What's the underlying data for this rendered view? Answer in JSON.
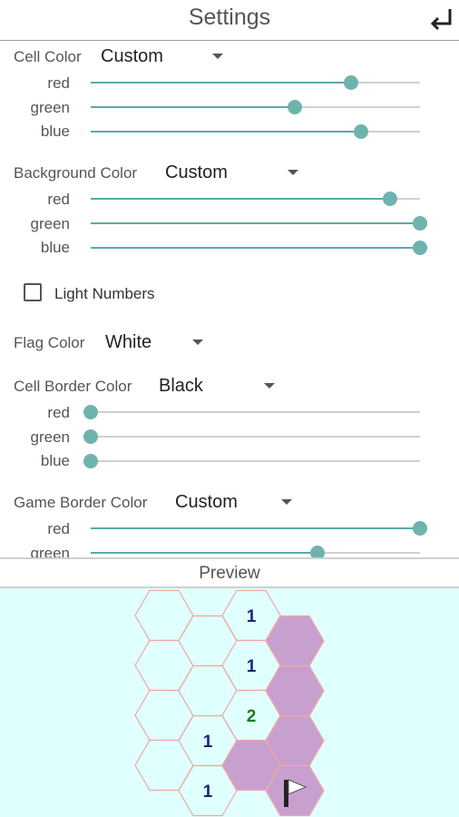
{
  "header": {
    "title": "Settings",
    "back_icon": "return-arrow-icon"
  },
  "cell_color": {
    "label": "Cell Color",
    "value": "Custom",
    "channels": [
      {
        "name": "red",
        "level": 0.79
      },
      {
        "name": "green",
        "level": 0.62
      },
      {
        "name": "blue",
        "level": 0.82
      }
    ]
  },
  "background_color": {
    "label": "Background Color",
    "value": "Custom",
    "channels": [
      {
        "name": "red",
        "level": 0.91
      },
      {
        "name": "green",
        "level": 1.0
      },
      {
        "name": "blue",
        "level": 1.0
      }
    ]
  },
  "light_numbers": {
    "label": "Light Numbers",
    "checked": false
  },
  "flag_color": {
    "label": "Flag Color",
    "value": "White"
  },
  "cell_border_color": {
    "label": "Cell Border Color",
    "value": "Black",
    "channels": [
      {
        "name": "red",
        "level": 0.0
      },
      {
        "name": "green",
        "level": 0.0
      },
      {
        "name": "blue",
        "level": 0.0
      }
    ]
  },
  "game_border_color": {
    "label": "Game Border Color",
    "value": "Custom",
    "channels": [
      {
        "name": "red",
        "level": 1.0
      },
      {
        "name": "green",
        "level": 0.69
      }
    ]
  },
  "preview": {
    "label": "Preview"
  },
  "colors": {
    "accent": "#5aaba5",
    "preview_bg": "#e0ffff",
    "hex_border": "#f0a8a0",
    "hex_covered": "#c8a0d0",
    "number_blue": "#1a237e",
    "number_green": "#1b7d1b"
  },
  "board": {
    "cells": [
      {
        "col": 0,
        "row": 0,
        "state": "open",
        "text": ""
      },
      {
        "col": 0,
        "row": 1,
        "state": "open",
        "text": ""
      },
      {
        "col": 0,
        "row": 2,
        "state": "open",
        "text": ""
      },
      {
        "col": 0,
        "row": 3,
        "state": "open",
        "text": ""
      },
      {
        "col": 1,
        "row": 0,
        "state": "open",
        "text": ""
      },
      {
        "col": 1,
        "row": 1,
        "state": "open",
        "text": ""
      },
      {
        "col": 1,
        "row": 2,
        "state": "open",
        "text": "1"
      },
      {
        "col": 1,
        "row": 3,
        "state": "open",
        "text": "1"
      },
      {
        "col": 2,
        "row": 0,
        "state": "open",
        "text": "1"
      },
      {
        "col": 2,
        "row": 1,
        "state": "open",
        "text": "1"
      },
      {
        "col": 2,
        "row": 2,
        "state": "open",
        "text": "2"
      },
      {
        "col": 2,
        "row": 3,
        "state": "covered",
        "text": ""
      },
      {
        "col": 3,
        "row": 0,
        "state": "covered",
        "text": ""
      },
      {
        "col": 3,
        "row": 1,
        "state": "covered",
        "text": ""
      },
      {
        "col": 3,
        "row": 2,
        "state": "covered",
        "text": ""
      },
      {
        "col": 3,
        "row": 3,
        "state": "flagged",
        "text": ""
      }
    ]
  }
}
